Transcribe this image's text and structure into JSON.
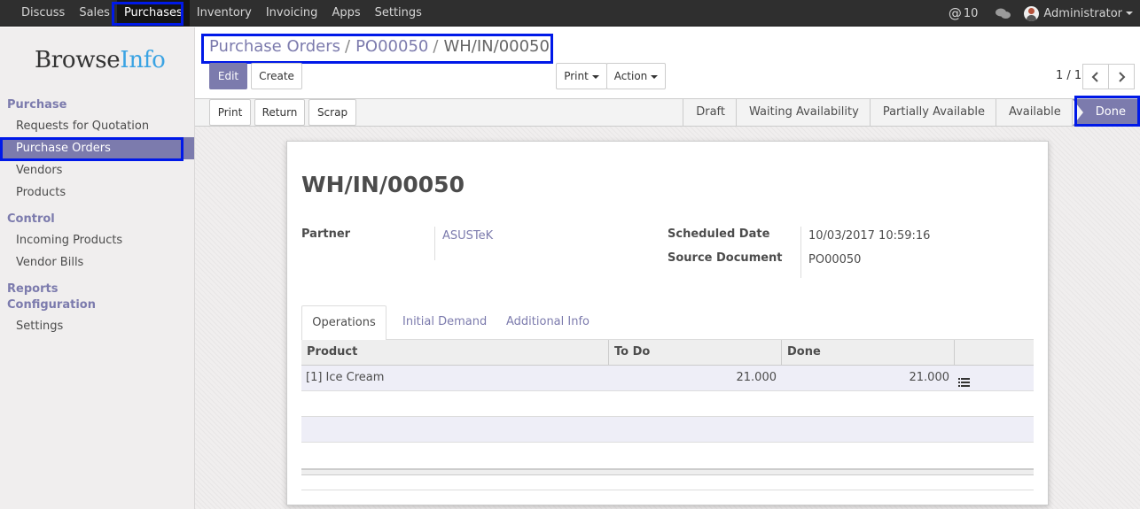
{
  "topbar": {
    "menu": [
      "Discuss",
      "Sales",
      "Purchases",
      "Inventory",
      "Invoicing",
      "Apps",
      "Settings"
    ],
    "active_menu": "Purchases",
    "at_symbol": "@",
    "mention_count": "10",
    "user_name": "Administrator"
  },
  "sidebar": {
    "logo_part1": "Browse",
    "logo_part2": "Info",
    "sections": {
      "purchase": "Purchase",
      "control": "Control",
      "reports": "Reports",
      "configuration": "Configuration"
    },
    "items": {
      "rfq": "Requests for Quotation",
      "purchase_orders": "Purchase Orders",
      "vendors": "Vendors",
      "products": "Products",
      "incoming_products": "Incoming Products",
      "vendor_bills": "Vendor Bills",
      "settings": "Settings"
    },
    "active_item": "Purchase Orders"
  },
  "breadcrumb": {
    "items": [
      "Purchase Orders",
      "PO00050"
    ],
    "separator": "/",
    "current": "WH/IN/00050"
  },
  "toolbar": {
    "edit": "Edit",
    "create": "Create",
    "print": "Print",
    "action": "Action",
    "pager": "1 / 1"
  },
  "statusbar": {
    "buttons": {
      "print": "Print",
      "return": "Return",
      "scrap": "Scrap"
    },
    "stages": [
      "Draft",
      "Waiting Availability",
      "Partially Available",
      "Available",
      "Done"
    ],
    "current_stage": "Done"
  },
  "form": {
    "title": "WH/IN/00050",
    "partner_label": "Partner",
    "partner_value": "ASUSTeK",
    "scheduled_date_label": "Scheduled Date",
    "scheduled_date_value": "10/03/2017 10:59:16",
    "source_document_label": "Source Document",
    "source_document_value": "PO00050"
  },
  "tabs": {
    "operations": "Operations",
    "initial_demand": "Initial Demand",
    "additional_info": "Additional Info",
    "active": "Operations"
  },
  "table": {
    "headers": {
      "product": "Product",
      "todo": "To Do",
      "done": "Done"
    },
    "rows": [
      {
        "product": "[1] Ice Cream",
        "todo": "21.000",
        "done": "21.000"
      }
    ]
  },
  "colors": {
    "accent": "#7c7bad",
    "topbar": "#2f2f2f",
    "highlight": "#0019e8",
    "logo_info": "#3aa3e3"
  }
}
